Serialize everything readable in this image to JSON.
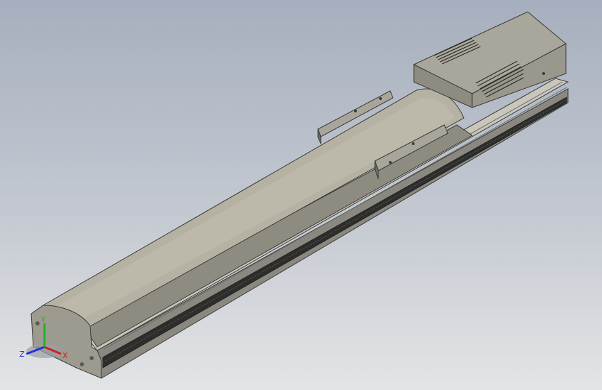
{
  "viewport": {
    "background_top": "#a6afbe",
    "background_bottom": "#e3e4e6"
  },
  "model": {
    "body_color": "#8e8c80",
    "top_color": "#b7b4a6",
    "motor_color": "#9a988c"
  },
  "triad": {
    "x_label": "X",
    "y_label": "Y",
    "z_label": "Z",
    "x_color": "#d21f1f",
    "y_color": "#1fb02c",
    "z_color": "#2430d8"
  }
}
